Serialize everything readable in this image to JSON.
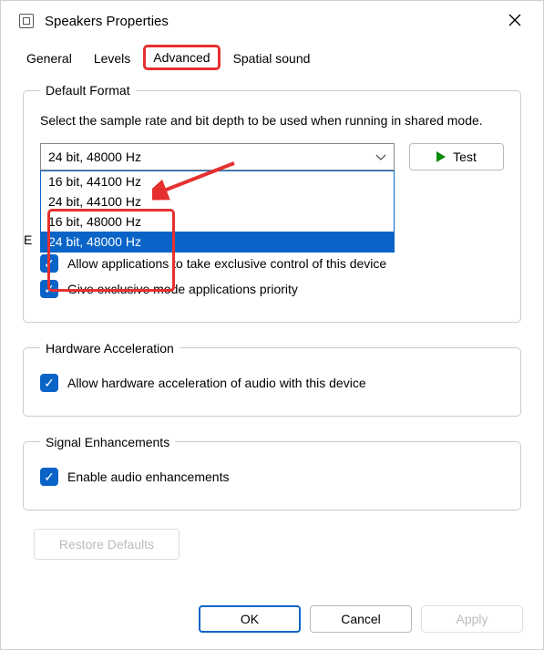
{
  "window": {
    "title": "Speakers Properties"
  },
  "tabs": {
    "items": [
      {
        "label": "General"
      },
      {
        "label": "Levels"
      },
      {
        "label": "Advanced"
      },
      {
        "label": "Spatial sound"
      }
    ]
  },
  "default_format": {
    "legend": "Default Format",
    "desc": "Select the sample rate and bit depth to be used when running in shared mode.",
    "selected": "24 bit, 48000 Hz",
    "options": [
      "16 bit, 44100 Hz",
      "24 bit, 44100 Hz",
      "16 bit, 48000 Hz",
      "24 bit, 48000 Hz"
    ],
    "test_label": "Test"
  },
  "exclusive": {
    "legend": "Exclusive Mode",
    "legend_visible_prefix": "E",
    "allow_label": "Allow applications to take exclusive control of this device",
    "allow_checked": true,
    "priority_label": "Give exclusive mode applications priority",
    "priority_checked": true
  },
  "hw_accel": {
    "legend": "Hardware Acceleration",
    "allow_label": "Allow hardware acceleration of audio with this device",
    "allow_checked": true
  },
  "signal": {
    "legend": "Signal Enhancements",
    "enable_label": "Enable audio enhancements",
    "enable_checked": true
  },
  "restore_label": "Restore Defaults",
  "footer": {
    "ok": "OK",
    "cancel": "Cancel",
    "apply": "Apply"
  },
  "annotation": {
    "arrow_color": "#e63030",
    "highlight_color": "#e63030"
  }
}
